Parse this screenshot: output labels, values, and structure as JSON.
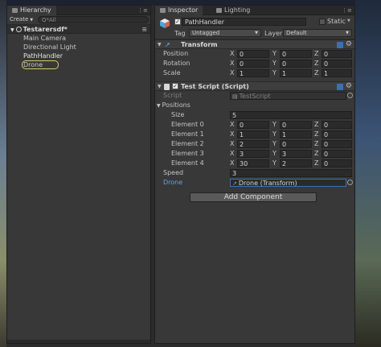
{
  "hierarchy": {
    "tab_label": "Hierarchy",
    "create_label": "Create",
    "search_placeholder": "Q*All",
    "scene_name": "Testarersdf*",
    "items": [
      {
        "label": "Main Camera"
      },
      {
        "label": "Directional Light"
      },
      {
        "label": "PathHandler"
      },
      {
        "label": "Drone"
      }
    ]
  },
  "inspector": {
    "tab_inspector": "Inspector",
    "tab_lighting": "Lighting",
    "object_name": "PathHandler",
    "active_checked": true,
    "static_label": "Static",
    "static_checked": false,
    "tag_label": "Tag",
    "tag_value": "Untagged",
    "layer_label": "Layer",
    "layer_value": "Default",
    "transform": {
      "title": "Transform",
      "position": {
        "label": "Position",
        "x": "0",
        "y": "0",
        "z": "0"
      },
      "rotation": {
        "label": "Rotation",
        "x": "0",
        "y": "0",
        "z": "0"
      },
      "scale": {
        "label": "Scale",
        "x": "1",
        "y": "1",
        "z": "1"
      }
    },
    "test_script": {
      "title": "Test Script (Script)",
      "enabled": true,
      "script_label": "Script",
      "script_value": "TestScript",
      "positions_label": "Positions",
      "size_label": "Size",
      "size_value": "5",
      "elements": [
        {
          "label": "Element 0",
          "x": "0",
          "y": "0",
          "z": "0"
        },
        {
          "label": "Element 1",
          "x": "1",
          "y": "1",
          "z": "0"
        },
        {
          "label": "Element 2",
          "x": "2",
          "y": "0",
          "z": "0"
        },
        {
          "label": "Element 3",
          "x": "3",
          "y": "3",
          "z": "0"
        },
        {
          "label": "Element 4",
          "x": "30",
          "y": "2",
          "z": "0"
        }
      ],
      "speed_label": "Speed",
      "speed_value": "3",
      "drone_label": "Drone",
      "drone_value": "Drone (Transform)"
    },
    "add_component_label": "Add Component"
  },
  "axis_labels": {
    "x": "X",
    "y": "Y",
    "z": "Z"
  },
  "colors": {
    "panel": "#383838",
    "selection_outline": "#d8c96a",
    "accent_blue": "#3c6ec2"
  }
}
